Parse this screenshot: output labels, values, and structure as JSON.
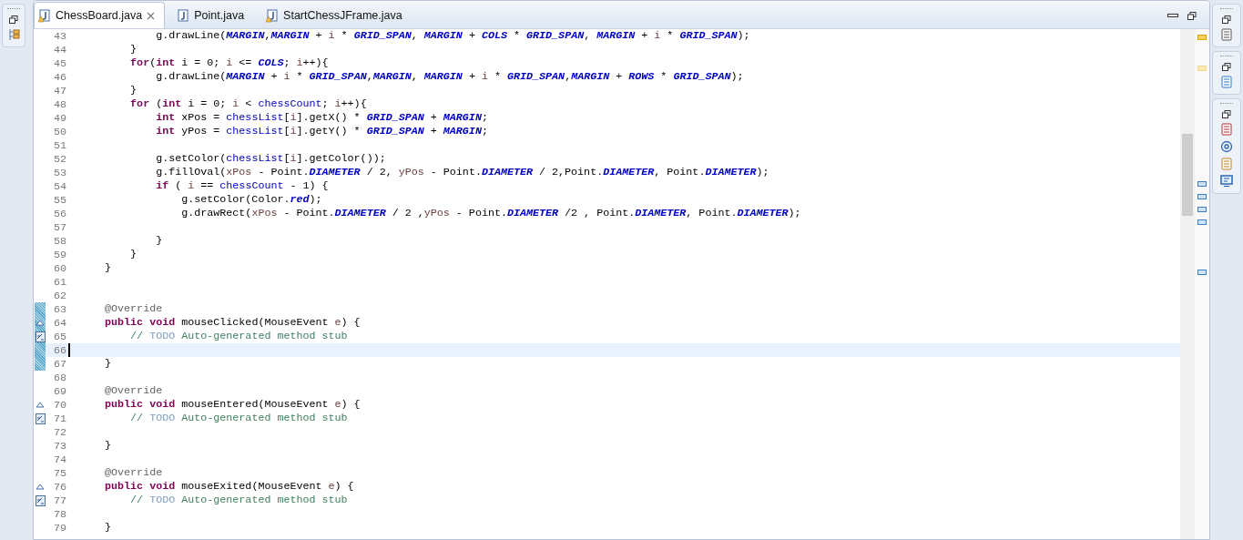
{
  "tabs": [
    {
      "label": "ChessBoard.java",
      "selected": true,
      "warning": true,
      "closable": true
    },
    {
      "label": "Point.java",
      "selected": false,
      "warning": false,
      "closable": false
    },
    {
      "label": "StartChessJFrame.java",
      "selected": false,
      "warning": true,
      "closable": false
    }
  ],
  "lines": [
    {
      "number": "43",
      "kind": "code",
      "current": false,
      "changed": false,
      "tokens": [
        {
          "kind": "plain",
          "text": "            g.drawLine("
        },
        {
          "kind": "constant",
          "text": "MARGIN"
        },
        {
          "kind": "plain",
          "text": ","
        },
        {
          "kind": "constant",
          "text": "MARGIN"
        },
        {
          "kind": "plain",
          "text": " + "
        },
        {
          "kind": "local",
          "text": "i"
        },
        {
          "kind": "plain",
          "text": " * "
        },
        {
          "kind": "constant",
          "text": "GRID_SPAN"
        },
        {
          "kind": "plain",
          "text": ", "
        },
        {
          "kind": "constant",
          "text": "MARGIN"
        },
        {
          "kind": "plain",
          "text": " + "
        },
        {
          "kind": "constant",
          "text": "COLS"
        },
        {
          "kind": "plain",
          "text": " * "
        },
        {
          "kind": "constant",
          "text": "GRID_SPAN"
        },
        {
          "kind": "plain",
          "text": ", "
        },
        {
          "kind": "constant",
          "text": "MARGIN"
        },
        {
          "kind": "plain",
          "text": " + "
        },
        {
          "kind": "local",
          "text": "i"
        },
        {
          "kind": "plain",
          "text": " * "
        },
        {
          "kind": "constant",
          "text": "GRID_SPAN"
        },
        {
          "kind": "plain",
          "text": ");"
        }
      ]
    },
    {
      "number": "44",
      "kind": "code",
      "current": false,
      "changed": false,
      "tokens": [
        {
          "kind": "plain",
          "text": "        }"
        }
      ]
    },
    {
      "number": "45",
      "kind": "code",
      "current": false,
      "changed": false,
      "tokens": [
        {
          "kind": "keyword",
          "text": "        for"
        },
        {
          "kind": "plain",
          "text": "("
        },
        {
          "kind": "keyword",
          "text": "int"
        },
        {
          "kind": "plain",
          "text": " i = 0; "
        },
        {
          "kind": "local",
          "text": "i"
        },
        {
          "kind": "plain",
          "text": " <= "
        },
        {
          "kind": "constant",
          "text": "COLS"
        },
        {
          "kind": "plain",
          "text": "; "
        },
        {
          "kind": "local",
          "text": "i"
        },
        {
          "kind": "plain",
          "text": "++){"
        }
      ]
    },
    {
      "number": "46",
      "kind": "code",
      "current": false,
      "changed": false,
      "tokens": [
        {
          "kind": "plain",
          "text": "            g.drawLine("
        },
        {
          "kind": "constant",
          "text": "MARGIN"
        },
        {
          "kind": "plain",
          "text": " + "
        },
        {
          "kind": "local",
          "text": "i"
        },
        {
          "kind": "plain",
          "text": " * "
        },
        {
          "kind": "constant",
          "text": "GRID_SPAN"
        },
        {
          "kind": "plain",
          "text": ","
        },
        {
          "kind": "constant",
          "text": "MARGIN"
        },
        {
          "kind": "plain",
          "text": ", "
        },
        {
          "kind": "constant",
          "text": "MARGIN"
        },
        {
          "kind": "plain",
          "text": " + "
        },
        {
          "kind": "local",
          "text": "i"
        },
        {
          "kind": "plain",
          "text": " * "
        },
        {
          "kind": "constant",
          "text": "GRID_SPAN"
        },
        {
          "kind": "plain",
          "text": ","
        },
        {
          "kind": "constant",
          "text": "MARGIN"
        },
        {
          "kind": "plain",
          "text": " + "
        },
        {
          "kind": "constant",
          "text": "ROWS"
        },
        {
          "kind": "plain",
          "text": " * "
        },
        {
          "kind": "constant",
          "text": "GRID_SPAN"
        },
        {
          "kind": "plain",
          "text": ");"
        }
      ]
    },
    {
      "number": "47",
      "kind": "code",
      "current": false,
      "changed": false,
      "tokens": [
        {
          "kind": "plain",
          "text": "        }"
        }
      ]
    },
    {
      "number": "48",
      "kind": "code",
      "current": false,
      "changed": false,
      "tokens": [
        {
          "kind": "keyword",
          "text": "        for"
        },
        {
          "kind": "plain",
          "text": " ("
        },
        {
          "kind": "keyword",
          "text": "int"
        },
        {
          "kind": "plain",
          "text": " i = 0; "
        },
        {
          "kind": "local",
          "text": "i"
        },
        {
          "kind": "plain",
          "text": " < "
        },
        {
          "kind": "field",
          "text": "chessCount"
        },
        {
          "kind": "plain",
          "text": "; "
        },
        {
          "kind": "local",
          "text": "i"
        },
        {
          "kind": "plain",
          "text": "++){"
        }
      ]
    },
    {
      "number": "49",
      "kind": "code",
      "current": false,
      "changed": false,
      "tokens": [
        {
          "kind": "keyword",
          "text": "            int"
        },
        {
          "kind": "plain",
          "text": " xPos = "
        },
        {
          "kind": "field",
          "text": "chessList"
        },
        {
          "kind": "plain",
          "text": "["
        },
        {
          "kind": "local",
          "text": "i"
        },
        {
          "kind": "plain",
          "text": "].getX() * "
        },
        {
          "kind": "constant",
          "text": "GRID_SPAN"
        },
        {
          "kind": "plain",
          "text": " + "
        },
        {
          "kind": "constant",
          "text": "MARGIN"
        },
        {
          "kind": "plain",
          "text": ";"
        }
      ]
    },
    {
      "number": "50",
      "kind": "code",
      "current": false,
      "changed": false,
      "tokens": [
        {
          "kind": "keyword",
          "text": "            int"
        },
        {
          "kind": "plain",
          "text": " yPos = "
        },
        {
          "kind": "field",
          "text": "chessList"
        },
        {
          "kind": "plain",
          "text": "["
        },
        {
          "kind": "local",
          "text": "i"
        },
        {
          "kind": "plain",
          "text": "].getY() * "
        },
        {
          "kind": "constant",
          "text": "GRID_SPAN"
        },
        {
          "kind": "plain",
          "text": " + "
        },
        {
          "kind": "constant",
          "text": "MARGIN"
        },
        {
          "kind": "plain",
          "text": ";"
        }
      ]
    },
    {
      "number": "51",
      "kind": "code",
      "current": false,
      "changed": false
    },
    {
      "number": "52",
      "kind": "code",
      "current": false,
      "changed": false,
      "tokens": [
        {
          "kind": "plain",
          "text": "            g.setColor("
        },
        {
          "kind": "field",
          "text": "chessList"
        },
        {
          "kind": "plain",
          "text": "["
        },
        {
          "kind": "local",
          "text": "i"
        },
        {
          "kind": "plain",
          "text": "].getColor());"
        }
      ]
    },
    {
      "number": "53",
      "kind": "code",
      "current": false,
      "changed": false,
      "tokens": [
        {
          "kind": "plain",
          "text": "            g.fillOval("
        },
        {
          "kind": "local",
          "text": "xPos"
        },
        {
          "kind": "plain",
          "text": " - Point."
        },
        {
          "kind": "constant",
          "text": "DIAMETER"
        },
        {
          "kind": "plain",
          "text": " / 2, "
        },
        {
          "kind": "local",
          "text": "yPos"
        },
        {
          "kind": "plain",
          "text": " - Point."
        },
        {
          "kind": "constant",
          "text": "DIAMETER"
        },
        {
          "kind": "plain",
          "text": " / 2,Point."
        },
        {
          "kind": "constant",
          "text": "DIAMETER"
        },
        {
          "kind": "plain",
          "text": ", Point."
        },
        {
          "kind": "constant",
          "text": "DIAMETER"
        },
        {
          "kind": "plain",
          "text": ");"
        }
      ]
    },
    {
      "number": "54",
      "kind": "code",
      "current": false,
      "changed": false,
      "tokens": [
        {
          "kind": "keyword",
          "text": "            if"
        },
        {
          "kind": "plain",
          "text": " ( "
        },
        {
          "kind": "local",
          "text": "i"
        },
        {
          "kind": "plain",
          "text": " == "
        },
        {
          "kind": "field",
          "text": "chessCount"
        },
        {
          "kind": "plain",
          "text": " - 1) {"
        }
      ]
    },
    {
      "number": "55",
      "kind": "code",
      "current": false,
      "changed": false,
      "tokens": [
        {
          "kind": "plain",
          "text": "                g.setColor(Color."
        },
        {
          "kind": "constant",
          "text": "red"
        },
        {
          "kind": "plain",
          "text": ");"
        }
      ]
    },
    {
      "number": "56",
      "kind": "code",
      "current": false,
      "changed": false,
      "tokens": [
        {
          "kind": "plain",
          "text": "                g.drawRect("
        },
        {
          "kind": "local",
          "text": "xPos"
        },
        {
          "kind": "plain",
          "text": " - Point."
        },
        {
          "kind": "constant",
          "text": "DIAMETER"
        },
        {
          "kind": "plain",
          "text": " / 2 ,"
        },
        {
          "kind": "local",
          "text": "yPos"
        },
        {
          "kind": "plain",
          "text": " - Point."
        },
        {
          "kind": "constant",
          "text": "DIAMETER"
        },
        {
          "kind": "plain",
          "text": " /2 , Point."
        },
        {
          "kind": "constant",
          "text": "DIAMETER"
        },
        {
          "kind": "plain",
          "text": ", Point."
        },
        {
          "kind": "constant",
          "text": "DIAMETER"
        },
        {
          "kind": "plain",
          "text": ");"
        }
      ]
    },
    {
      "number": "57",
      "kind": "code",
      "current": false,
      "changed": false
    },
    {
      "number": "58",
      "kind": "code",
      "current": false,
      "changed": false,
      "tokens": [
        {
          "kind": "plain",
          "text": "            }"
        }
      ]
    },
    {
      "number": "59",
      "kind": "code",
      "current": false,
      "changed": false,
      "tokens": [
        {
          "kind": "plain",
          "text": "        }"
        }
      ]
    },
    {
      "number": "60",
      "kind": "code",
      "current": false,
      "changed": false,
      "tokens": [
        {
          "kind": "plain",
          "text": "    }"
        }
      ]
    },
    {
      "number": "61",
      "kind": "code",
      "current": false,
      "changed": false
    },
    {
      "number": "62",
      "kind": "code",
      "current": false,
      "changed": false
    },
    {
      "number": "63",
      "kind": "code",
      "current": false,
      "changed": true,
      "tokens": [
        {
          "kind": "annotation",
          "text": "    @Override"
        }
      ]
    },
    {
      "number": "64",
      "kind": "override",
      "current": false,
      "changed": true,
      "tokens": [
        {
          "kind": "keyword",
          "text": "    public void"
        },
        {
          "kind": "plain",
          "text": " mouseClicked(MouseEvent "
        },
        {
          "kind": "local",
          "text": "e"
        },
        {
          "kind": "plain",
          "text": ") {"
        }
      ]
    },
    {
      "number": "65",
      "kind": "task",
      "current": false,
      "changed": true,
      "tokens": [
        {
          "kind": "comment",
          "text": "        // "
        },
        {
          "kind": "todo",
          "text": "TODO"
        },
        {
          "kind": "comment",
          "text": " Auto-generated method stub"
        }
      ]
    },
    {
      "number": "66",
      "kind": "code",
      "current": true,
      "changed": true
    },
    {
      "number": "67",
      "kind": "code",
      "current": false,
      "changed": true,
      "tokens": [
        {
          "kind": "plain",
          "text": "    }"
        }
      ]
    },
    {
      "number": "68",
      "kind": "code",
      "current": false,
      "changed": false
    },
    {
      "number": "69",
      "kind": "code",
      "current": false,
      "changed": false,
      "tokens": [
        {
          "kind": "annotation",
          "text": "    @Override"
        }
      ]
    },
    {
      "number": "70",
      "kind": "override",
      "current": false,
      "changed": false,
      "tokens": [
        {
          "kind": "keyword",
          "text": "    public void"
        },
        {
          "kind": "plain",
          "text": " mouseEntered(MouseEvent "
        },
        {
          "kind": "local",
          "text": "e"
        },
        {
          "kind": "plain",
          "text": ") {"
        }
      ]
    },
    {
      "number": "71",
      "kind": "task",
      "current": false,
      "changed": false,
      "tokens": [
        {
          "kind": "comment",
          "text": "        // "
        },
        {
          "kind": "todo",
          "text": "TODO"
        },
        {
          "kind": "comment",
          "text": " Auto-generated method stub"
        }
      ]
    },
    {
      "number": "72",
      "kind": "code",
      "current": false,
      "changed": false
    },
    {
      "number": "73",
      "kind": "code",
      "current": false,
      "changed": false,
      "tokens": [
        {
          "kind": "plain",
          "text": "    }"
        }
      ]
    },
    {
      "number": "74",
      "kind": "code",
      "current": false,
      "changed": false
    },
    {
      "number": "75",
      "kind": "code",
      "current": false,
      "changed": false,
      "tokens": [
        {
          "kind": "annotation",
          "text": "    @Override"
        }
      ]
    },
    {
      "number": "76",
      "kind": "override",
      "current": false,
      "changed": false,
      "tokens": [
        {
          "kind": "keyword",
          "text": "    public void"
        },
        {
          "kind": "plain",
          "text": " mouseExited(MouseEvent "
        },
        {
          "kind": "local",
          "text": "e"
        },
        {
          "kind": "plain",
          "text": ") {"
        }
      ]
    },
    {
      "number": "77",
      "kind": "task",
      "current": false,
      "changed": false,
      "tokens": [
        {
          "kind": "comment",
          "text": "        // "
        },
        {
          "kind": "todo",
          "text": "TODO"
        },
        {
          "kind": "comment",
          "text": " Auto-generated method stub"
        }
      ]
    },
    {
      "number": "78",
      "kind": "code",
      "current": false,
      "changed": false
    },
    {
      "number": "79",
      "kind": "code",
      "current": false,
      "changed": false,
      "tokens": [
        {
          "kind": "plain",
          "text": "    }"
        }
      ]
    }
  ]
}
